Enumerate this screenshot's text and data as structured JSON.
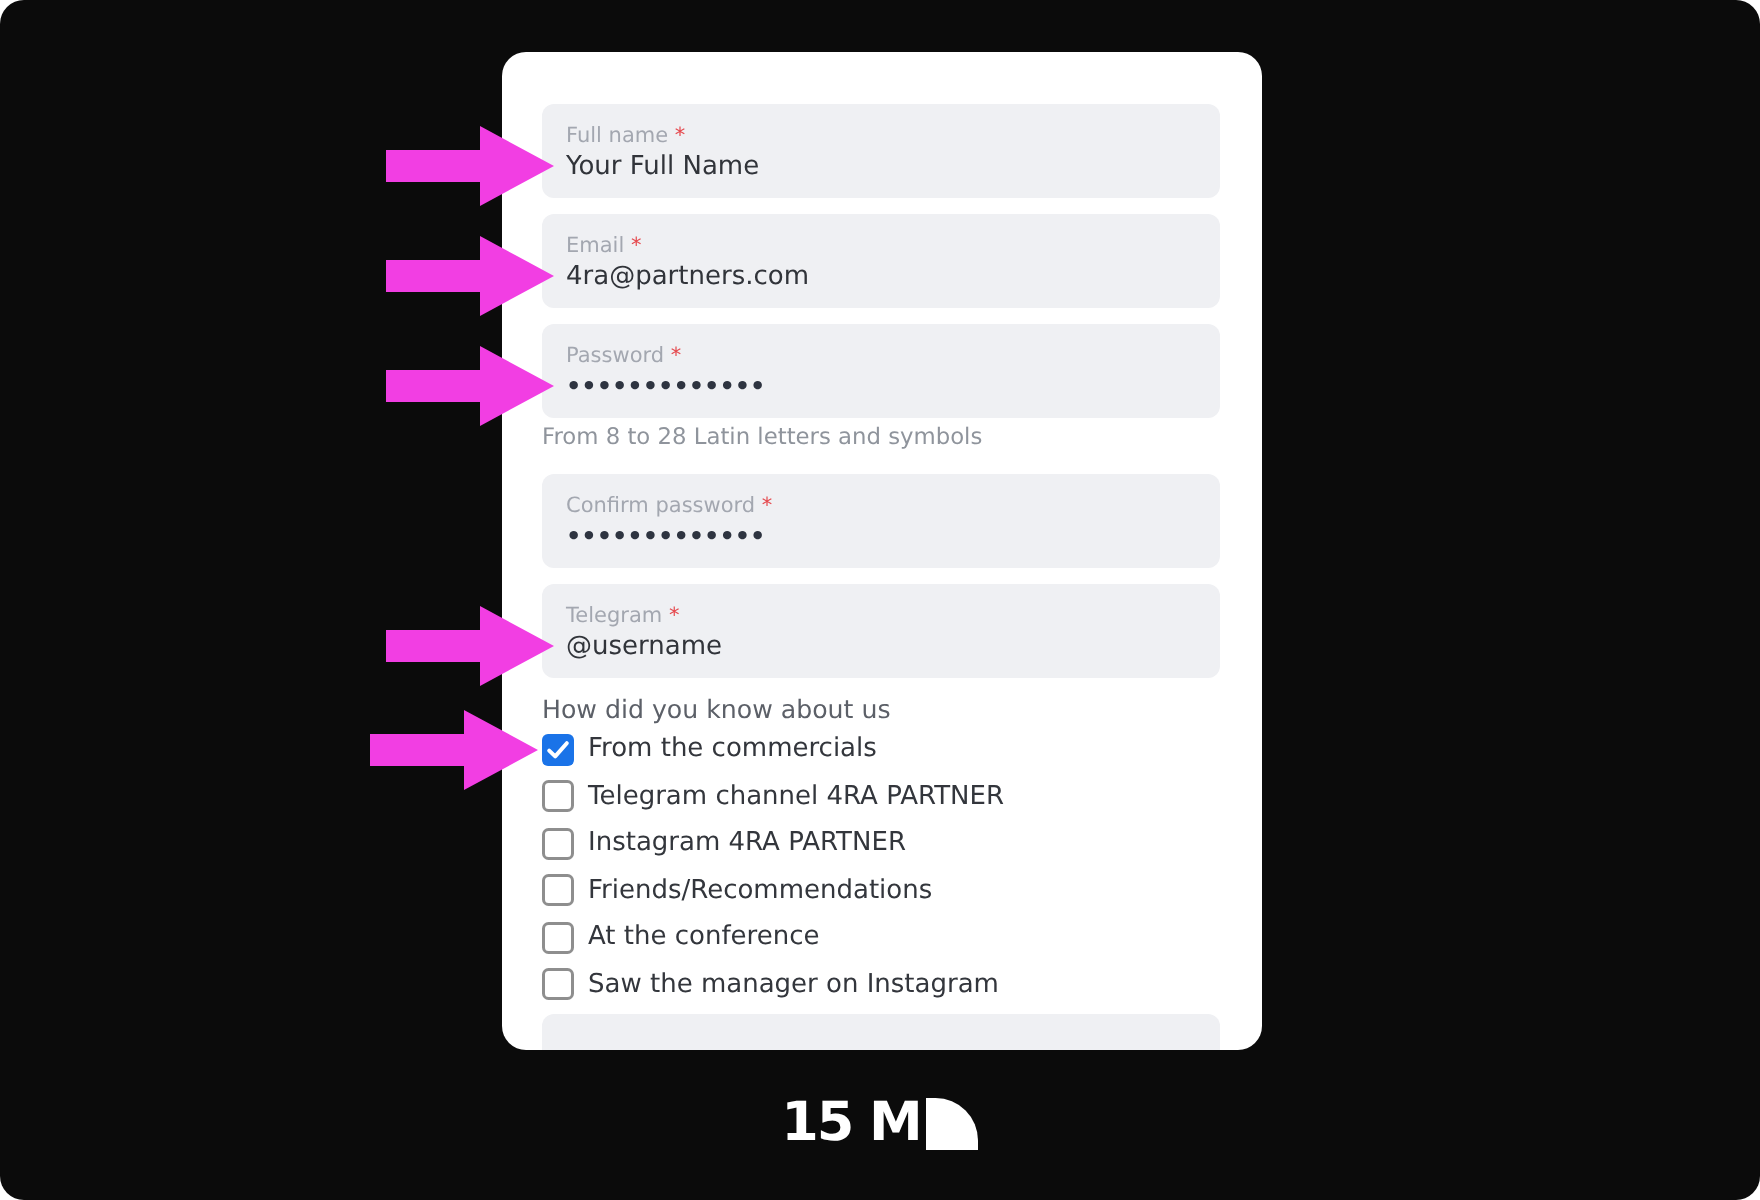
{
  "form": {
    "fields": [
      {
        "kind": "text",
        "label": "Full name",
        "required_mark": "*",
        "value": "Your Full Name",
        "arrow": true
      },
      {
        "kind": "text",
        "label": "Email",
        "required_mark": "*",
        "value": "4ra@partners.com",
        "arrow": true
      },
      {
        "kind": "password",
        "label": "Password",
        "required_mark": "*",
        "value": "•••••••••••••",
        "hint": "From 8 to 28 Latin letters and symbols",
        "arrow": true
      },
      {
        "kind": "password",
        "label": "Confirm password",
        "required_mark": "*",
        "value": "•••••••••••••",
        "arrow": false
      },
      {
        "kind": "text",
        "label": "Telegram",
        "required_mark": "*",
        "value": "@username",
        "arrow": true
      }
    ],
    "question": {
      "label": "How did you know about us",
      "options": [
        {
          "label": "From the commercials",
          "checked": true,
          "arrow": true
        },
        {
          "label": "Telegram channel 4RA PARTNER",
          "checked": false,
          "arrow": false
        },
        {
          "label": "Instagram 4RA PARTNER",
          "checked": false,
          "arrow": false
        },
        {
          "label": "Friends/Recommendations",
          "checked": false,
          "arrow": false
        },
        {
          "label": "At the conference",
          "checked": false,
          "arrow": false
        },
        {
          "label": "Saw the manager on Instagram",
          "checked": false,
          "arrow": false
        }
      ]
    },
    "trailing_fields": [
      {
        "kind": "blank"
      }
    ]
  },
  "logo": {
    "text": "15 M"
  }
}
